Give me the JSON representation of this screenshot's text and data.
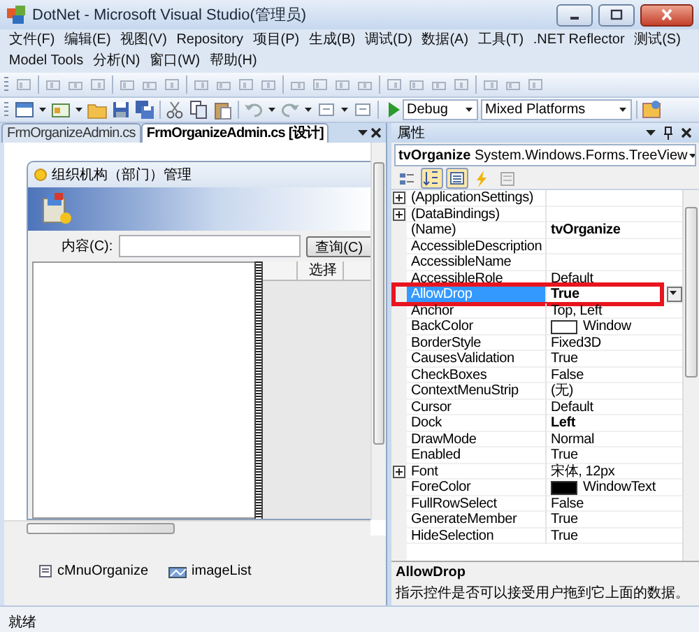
{
  "window": {
    "title": "DotNet - Microsoft Visual Studio(管理员)"
  },
  "menu": [
    "文件(F)",
    "编辑(E)",
    "视图(V)",
    "Repository",
    "项目(P)",
    "生成(B)",
    "调试(D)",
    "数据(A)",
    "工具(T)",
    ".NET Reflector",
    "测试(S)",
    "Model Tools",
    "分析(N)",
    "窗口(W)",
    "帮助(H)"
  ],
  "toolbar": {
    "configuration": "Debug",
    "platform": "Mixed Platforms"
  },
  "document_tabs": [
    {
      "label": "FrmOrganizeAdmin.cs",
      "selected": false
    },
    {
      "label": "FrmOrganizeAdmin.cs [设计]",
      "selected": true
    }
  ],
  "designer": {
    "form_title": "组织机构（部门）管理",
    "search_label": "内容(C):",
    "search_button": "查询(C)",
    "grid_columns": [
      "选择"
    ],
    "components": [
      "cMnuOrganize",
      "imageList"
    ]
  },
  "properties": {
    "title": "属性",
    "object": "**tvOrganize** System.Windows.Forms.TreeView",
    "toolbar_buttons": [
      {
        "kind": "categorized",
        "selected": false
      },
      {
        "kind": "alphabetical",
        "selected": true
      },
      {
        "kind": "properties",
        "selected": true
      },
      {
        "kind": "events",
        "selected": false
      },
      {
        "kind": "pages",
        "selected": false
      }
    ],
    "rows": [
      {
        "name": "(ApplicationSettings)",
        "value": "",
        "expandable": true,
        "selected": false,
        "annotated": false
      },
      {
        "name": "(DataBindings)",
        "value": "",
        "expandable": true,
        "selected": false,
        "annotated": false
      },
      {
        "name": "(Name)",
        "value": "tvOrganize",
        "expandable": false,
        "bold": true,
        "selected": false,
        "annotated": false
      },
      {
        "name": "AccessibleDescription",
        "value": "",
        "expandable": false,
        "selected": false,
        "annotated": false
      },
      {
        "name": "AccessibleName",
        "value": "",
        "expandable": false,
        "selected": false,
        "annotated": false
      },
      {
        "name": "AccessibleRole",
        "value": "Default",
        "expandable": false,
        "bold": false,
        "selected": false,
        "annotated": false
      },
      {
        "name": "AllowDrop",
        "value": "True",
        "expandable": false,
        "bold": true,
        "selected": true,
        "annotated": true
      },
      {
        "name": "Anchor",
        "value": "Top, Left",
        "expandable": false,
        "bold": false,
        "selected": false,
        "annotated": false
      },
      {
        "name": "BackColor",
        "value": "Window",
        "color": "#ffffff",
        "expandable": false,
        "bold": false,
        "selected": false,
        "annotated": false
      },
      {
        "name": "BorderStyle",
        "value": "Fixed3D",
        "expandable": false,
        "bold": false,
        "selected": false,
        "annotated": false
      },
      {
        "name": "CausesValidation",
        "value": "True",
        "expandable": false,
        "bold": false,
        "selected": false,
        "annotated": false
      },
      {
        "name": "CheckBoxes",
        "value": "False",
        "expandable": false,
        "bold": false,
        "selected": false,
        "annotated": false
      },
      {
        "name": "ContextMenuStrip",
        "value": "(无)",
        "expandable": false,
        "bold": false,
        "selected": false,
        "annotated": false
      },
      {
        "name": "Cursor",
        "value": "Default",
        "expandable": false,
        "bold": false,
        "selected": false,
        "annotated": false
      },
      {
        "name": "Dock",
        "value": "Left",
        "expandable": false,
        "bold": true,
        "selected": false,
        "annotated": false
      },
      {
        "name": "DrawMode",
        "value": "Normal",
        "expandable": false,
        "bold": false,
        "selected": false,
        "annotated": false
      },
      {
        "name": "Enabled",
        "value": "True",
        "expandable": false,
        "bold": false,
        "selected": false,
        "annotated": false
      },
      {
        "name": "Font",
        "value": "宋体, 12px",
        "expandable": true,
        "bold": false,
        "selected": false,
        "annotated": false
      },
      {
        "name": "ForeColor",
        "value": "WindowText",
        "color": "#000000",
        "expandable": false,
        "bold": false,
        "selected": false,
        "annotated": false
      },
      {
        "name": "FullRowSelect",
        "value": "False",
        "expandable": false,
        "bold": false,
        "selected": false,
        "annotated": false
      },
      {
        "name": "GenerateMember",
        "value": "True",
        "expandable": false,
        "bold": false,
        "selected": false,
        "annotated": false
      },
      {
        "name": "HideSelection",
        "value": "True",
        "expandable": false,
        "bold": false,
        "selected": false,
        "annotated": false
      }
    ],
    "description": {
      "title": "AllowDrop",
      "text": "指示控件是否可以接受用户拖到它上面的数据。"
    }
  },
  "status_bar": "就绪"
}
